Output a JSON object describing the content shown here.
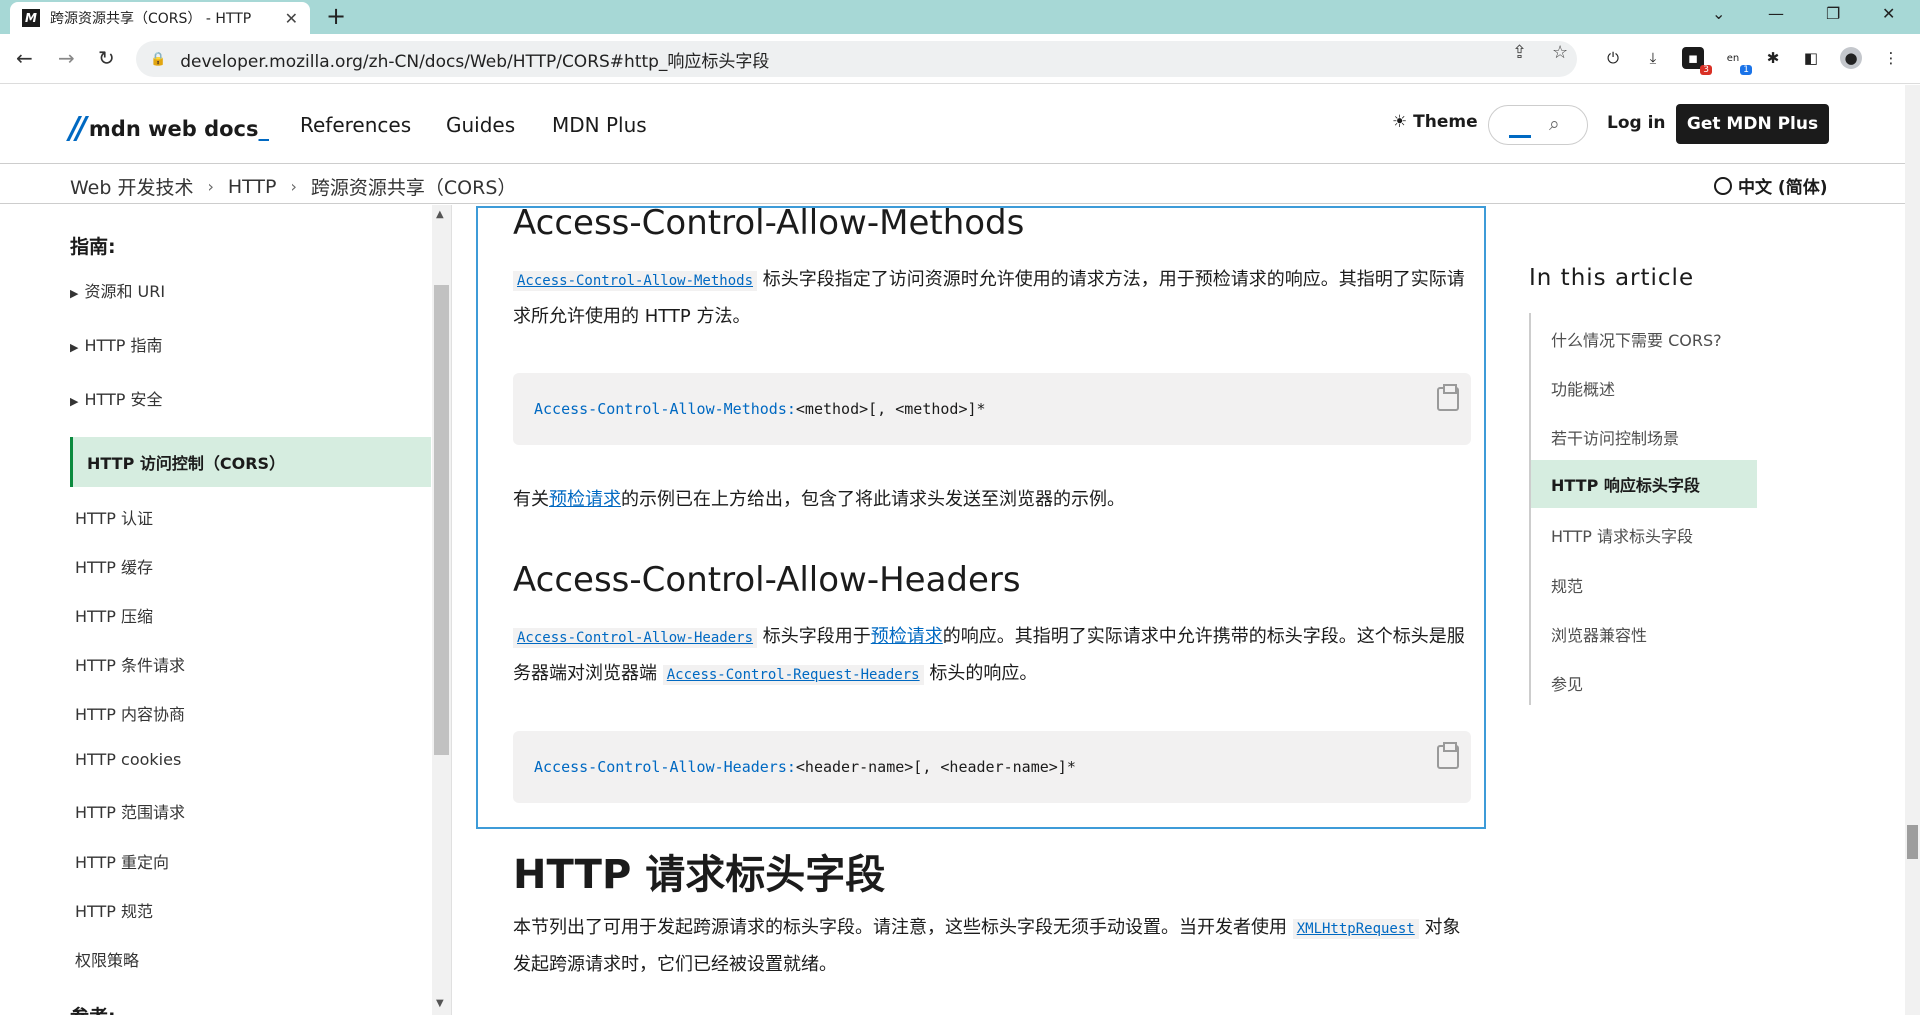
{
  "browser": {
    "tab_title": "跨源资源共享（CORS） - HTTP",
    "tab_close": "✕",
    "new_tab": "+",
    "url": "developer.mozilla.org/zh-CN/docs/Web/HTTP/CORS#http_响应标头字段",
    "ext_badge_1": "3",
    "ext_badge_2": "1",
    "ext_badge_2_label": "en"
  },
  "header": {
    "logo_text": "mdn web docs",
    "nav": [
      "References",
      "Guides",
      "MDN Plus"
    ],
    "theme_label": "Theme",
    "login_label": "Log in",
    "cta_label": "Get MDN Plus"
  },
  "breadcrumb": {
    "items": [
      "Web 开发技术",
      "HTTP",
      "跨源资源共享（CORS）"
    ],
    "language": "中文 (简体)"
  },
  "sidebar": {
    "heading": "指南:",
    "groups": [
      "资源和 URI",
      "HTTP 指南",
      "HTTP 安全"
    ],
    "active": "HTTP 访问控制（CORS）",
    "items": [
      "HTTP 认证",
      "HTTP 缓存",
      "HTTP 压缩",
      "HTTP 条件请求",
      "HTTP 内容协商",
      "HTTP cookies",
      "HTTP 范围请求",
      "HTTP 重定向",
      "HTTP 规范",
      "权限策略"
    ],
    "next_heading": "参考:"
  },
  "article": {
    "methods": {
      "heading": "Access-Control-Allow-Methods",
      "code_ref": "Access-Control-Allow-Methods",
      "text_1": " 标头字段指定了访问资源时允许使用的请求方法，用于预检请求的响应。其指明了实际请求所允许使用的 HTTP 方法。",
      "code_key": "Access-Control-Allow-Methods:",
      "code_rest": " <method>[, <method>]*",
      "note_pre": "有关",
      "note_link": "预检请求",
      "note_post": "的示例已在上方给出，包含了将此请求头发送至浏览器的示例。"
    },
    "headers": {
      "heading": "Access-Control-Allow-Headers",
      "code_ref": "Access-Control-Allow-Headers",
      "text_1": " 标头字段用于",
      "link": "预检请求",
      "text_2": "的响应。其指明了实际请求中允许携带的标头字段。这个标头是服务器端对浏览器端 ",
      "code_ref_2": "Access-Control-Request-Headers",
      "text_3": " 标头的响应。",
      "code_key": "Access-Control-Allow-Headers:",
      "code_rest": " <header-name>[, <header-name>]*"
    },
    "request": {
      "heading": "HTTP 请求标头字段",
      "text_1": "本节列出了可用于发起跨源请求的标头字段。请注意，这些标头字段无须手动设置。当开发者使用 ",
      "code_ref": "XMLHttpRequest",
      "text_2": " 对象发起跨源请求时，它们已经被设置就绪。"
    }
  },
  "toc": {
    "title": "In this article",
    "items": [
      "什么情况下需要 CORS?",
      "功能概述",
      "若干访问控制场景",
      "HTTP 响应标头字段",
      "HTTP 请求标头字段",
      "规范",
      "浏览器兼容性",
      "参见"
    ],
    "active_index": 3
  }
}
